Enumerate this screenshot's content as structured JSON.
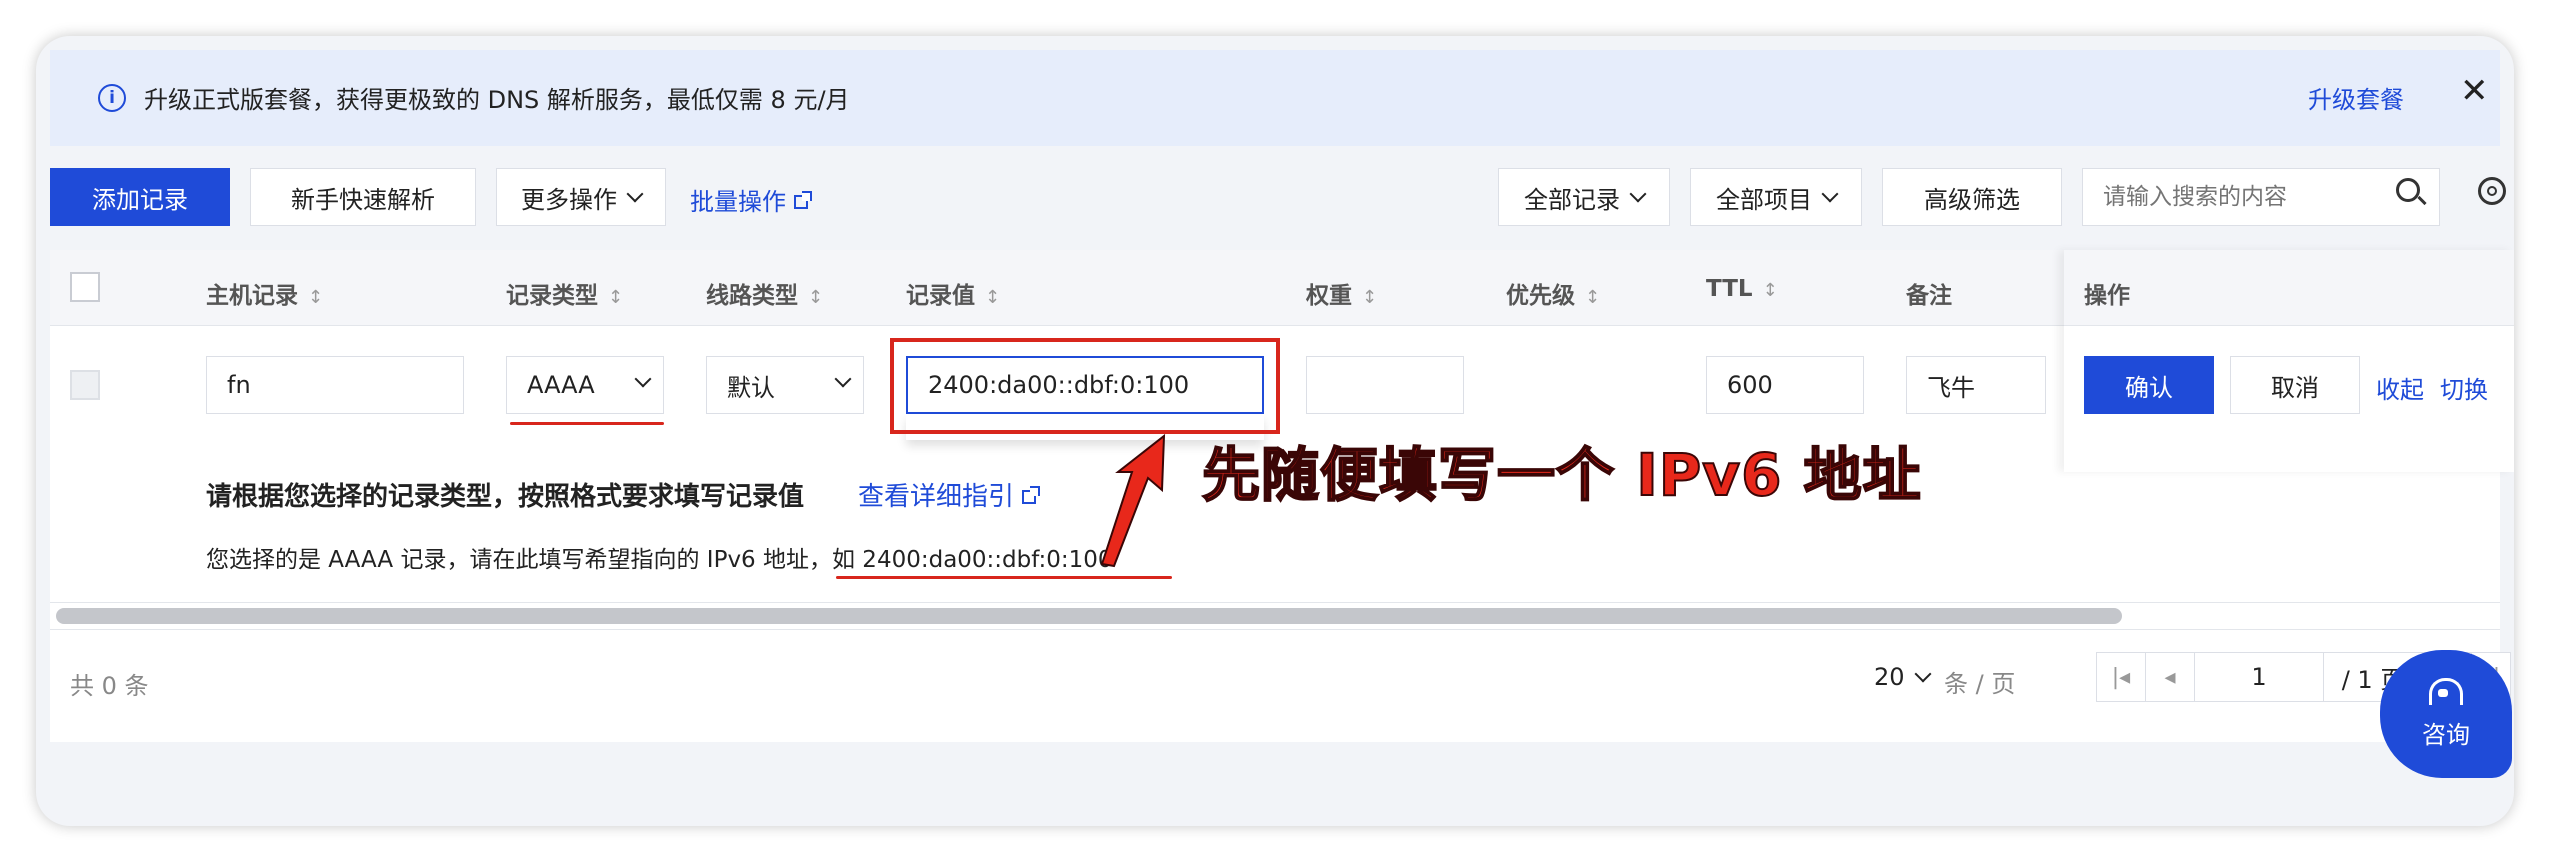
{
  "banner": {
    "text": "升级正式版套餐，获得更极致的 DNS 解析服务，最低仅需 8 元/月",
    "upgrade_link": "升级套餐",
    "close": "✕"
  },
  "toolbar": {
    "add_record": "添加记录",
    "quick_resolve": "新手快速解析",
    "more_actions": "更多操作",
    "batch_actions": "批量操作",
    "all_records": "全部记录",
    "all_projects": "全部项目",
    "advanced_filter": "高级筛选",
    "search_placeholder": "请输入搜索的内容"
  },
  "table": {
    "headers": {
      "host": "主机记录",
      "type": "记录类型",
      "line": "线路类型",
      "value": "记录值",
      "weight": "权重",
      "priority": "优先级",
      "ttl": "TTL",
      "remark": "备注",
      "ops": "操作"
    },
    "sort_glyph": "↕",
    "edit_row": {
      "host": "fn",
      "type": "AAAA",
      "line": "默认",
      "value": "2400:da00::dbf:0:100",
      "weight": "",
      "ttl": "600",
      "remark": "飞牛",
      "confirm": "确认",
      "cancel": "取消",
      "collapse": "收起",
      "switch": "切换"
    }
  },
  "hint": {
    "title": "请根据您选择的记录类型，按照格式要求填写记录值",
    "guide_link": "查看详细指引",
    "body": "您选择的是 AAAA 记录，请在此填写希望指向的 IPv6 地址，如 2400:da00::dbf:0:100"
  },
  "annotation": {
    "text": "先随便填写一个 IPv6 地址",
    "color": "#e8281b"
  },
  "footer": {
    "total": "共 0 条",
    "page_size": "20",
    "page_size_unit": "条 / 页",
    "current_page": "1",
    "total_pages": "/ 1 页"
  },
  "consult": {
    "label": "咨询"
  },
  "colors": {
    "primary": "#1f4bd8",
    "annotation_red": "#d8261c",
    "banner_bg": "#e6edfb"
  }
}
